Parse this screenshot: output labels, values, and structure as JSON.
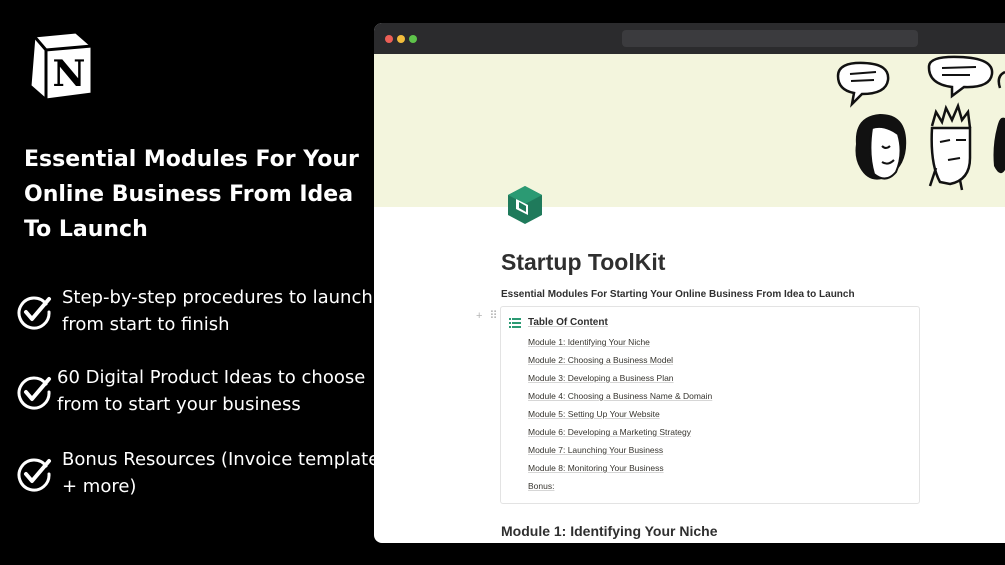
{
  "promo": {
    "headline": "Essential Modules For Your Online Business From Idea To Launch",
    "features": [
      "Step-by-step procedures to launch from start to finish",
      "60 Digital Product Ideas to choose from to start your business",
      "Bonus Resources (Invoice template + more)"
    ]
  },
  "icons": {
    "logo": "notion-logo-icon",
    "check": "checkmark-circle-icon",
    "page": "cube-page-icon",
    "toc": "list-icon"
  },
  "colors": {
    "cover": "#f3f5dd",
    "page_icon": "#1f7a5b",
    "window_red": "#ec5f56",
    "window_yellow": "#f2bd3c",
    "window_green": "#5ec34a"
  },
  "page": {
    "title": "Startup ToolKit",
    "subtitle": "Essential Modules For Starting Your Online Business From Idea to Launch",
    "toc_title": "Table Of Content",
    "toc_items": [
      "Module 1: Identifying Your Niche",
      "Module 2: Choosing a Business Model",
      "Module 3: Developing a Business Plan",
      "Module 4: Choosing a Business Name & Domain",
      "Module 5: Setting Up Your Website",
      "Module 6: Developing a Marketing Strategy",
      "Module 7: Launching Your Business",
      "Module 8: Monitoring Your Business",
      "Bonus:"
    ],
    "heading": "Module 1: Identifying Your Niche"
  }
}
